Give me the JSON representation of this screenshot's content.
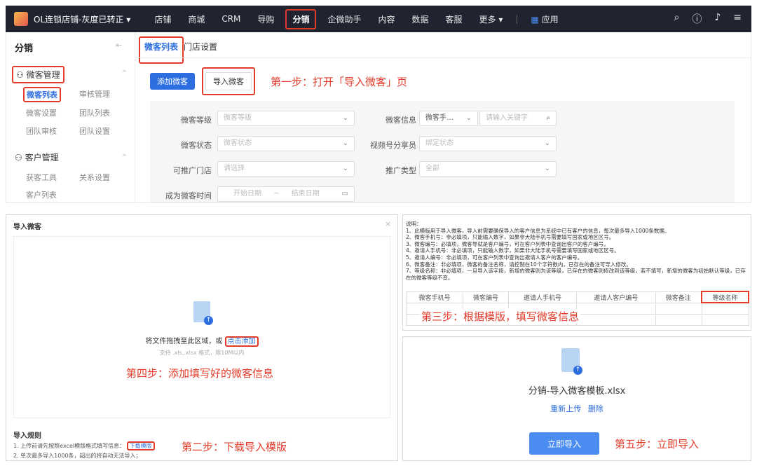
{
  "nav": {
    "store_name": "OL连锁店铺-灰度已转正 ▾",
    "items": [
      "店铺",
      "商城",
      "CRM",
      "导购",
      "分销",
      "企微助手",
      "内容",
      "数据",
      "客服",
      "更多 ▾"
    ],
    "app_label": "应用"
  },
  "sidebar": {
    "title": "分销",
    "group1": "微客管理",
    "group1_items": [
      "微客列表",
      "审核管理",
      "微客设置",
      "团队列表",
      "团队审核",
      "团队设置"
    ],
    "group2": "客户管理",
    "group2_items": [
      "获客工具",
      "关系设置",
      "客户列表"
    ]
  },
  "main": {
    "tabs": [
      "微客列表",
      "门店设置"
    ],
    "add_button": "添加微客",
    "import_button": "导入微客",
    "step1": "第一步：打开「导入微客」页",
    "filters": {
      "level_label": "微客等级",
      "level_placeholder": "微客等级",
      "info_label": "微客信息",
      "info_select": "微客手…",
      "info_placeholder": "请输入关键字",
      "status_label": "微客状态",
      "status_placeholder": "微客状态",
      "sharer_label": "视频号分享员",
      "sharer_placeholder": "绑定状态",
      "store_label": "可推广门店",
      "store_placeholder": "请选择",
      "promo_label": "推广类型",
      "promo_placeholder": "全部",
      "time_label": "成为微客时间",
      "start_placeholder": "开始日期",
      "date_sep": "~",
      "end_placeholder": "结束日期"
    }
  },
  "import_dialog": {
    "title": "导入微客",
    "drop_text": "将文件拖拽至此区域，或",
    "drop_link": "点击添加",
    "format_hint": "支持 .xls,.xlsx 格式，限10M以内",
    "step4": "第四步：添加填写好的微客信息",
    "rules_title": "导入规则",
    "rule1": "1. 上传前请先按照excel模版格式填写信息：",
    "rule1_link": "下载模版",
    "rule2": "2. 单次最多导入1000条，超出的将自动无法导入；",
    "step2": "第二步：下载导入模版"
  },
  "template": {
    "notes": [
      "说明：",
      "1、此模版用于导入微客，导入前需要确保导入的客户信息为系统中已有客户的信息，每次最多导入1000条数据。",
      "2、微客手机号：非必填项，只能输入数字，如果非大陆手机号需要填写国家或地区区号。",
      "3、微客编号：必填项，微客导就是客户编号，可在客户列表中查询出客户的客户编号。",
      "4、邀请人手机号：非必填项，只能输入数字，如果非大陆手机号需要填写国家或地区区号。",
      "5、邀请人编号：非必填项，可在客户列表中查询出邀请人客户的客户编号。",
      "6、微客备注：非必填项，微客的备注名称，请控制在10个字符数内，已存在的备注可导入修改。",
      "7、等级名称：非必填项，一旦导入该字段，新增的微客则为该等级，已存在的微客则修改到该等级，若不填写，新增的微客为初始默认等级，已存在的微客等级不变。"
    ],
    "columns": [
      "微客手机号",
      "微客编号",
      "邀请人手机号",
      "邀请人客户编号",
      "微客备注",
      "等级名称"
    ],
    "step3": "第三步：根据模版，填写微客信息"
  },
  "uploaded": {
    "file_name": "分销-导入微客模板.xlsx",
    "reupload": "重新上传",
    "delete": "删除",
    "import_now": "立即导入",
    "step5": "第五步：立即导入"
  },
  "colors": {
    "accent": "#2c6ee0",
    "highlight": "#e23b2a",
    "nav_bg": "#1f2430"
  }
}
